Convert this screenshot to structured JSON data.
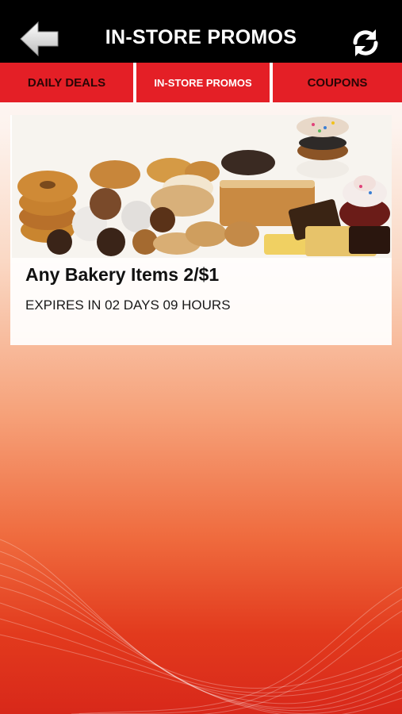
{
  "header": {
    "title": "IN-STORE PROMOS",
    "back_icon": "back-arrow-icon",
    "refresh_icon": "refresh-icon"
  },
  "tabs": [
    {
      "label": "DAILY DEALS",
      "selected": false
    },
    {
      "label": "IN-STORE PROMOS",
      "selected": true
    },
    {
      "label": "COUPONS",
      "selected": false
    }
  ],
  "promos": [
    {
      "title": "Any Bakery Items 2/$1",
      "expiry": "EXPIRES IN 02 DAYS 09 HOURS",
      "image": "bakery-items-image"
    }
  ],
  "colors": {
    "header_bg": "#000000",
    "tab_bg": "#e41f26",
    "tab_text": "#2a0606",
    "tab_selected_text": "#ffffff",
    "background_top": "#ffffff",
    "background_bottom": "#d8281a"
  }
}
